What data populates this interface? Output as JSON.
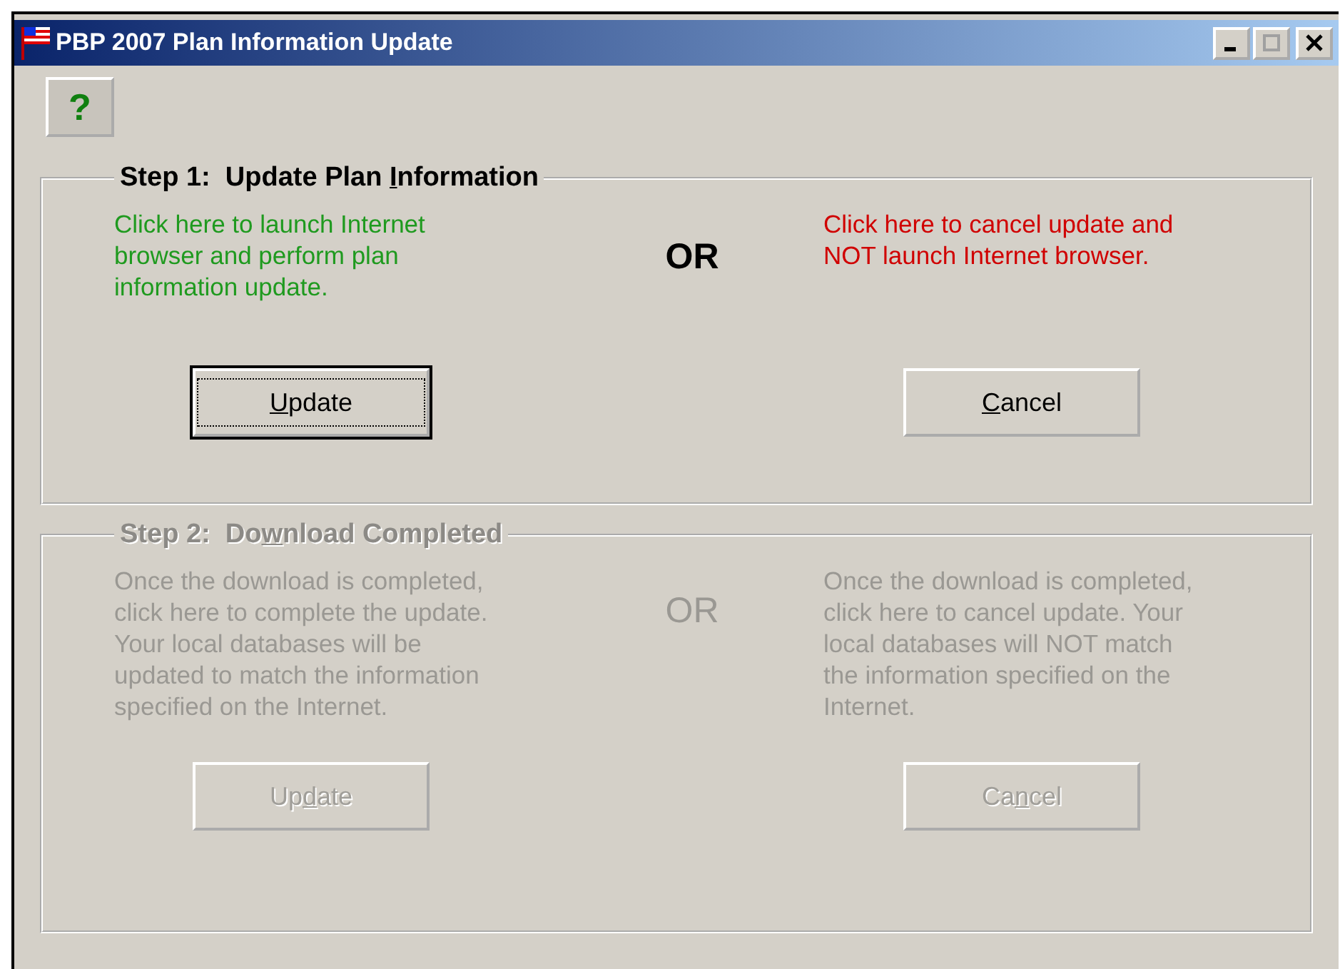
{
  "window": {
    "title": "PBP 2007 Plan Information Update",
    "maximize": {
      "disabled": true
    }
  },
  "help_button": {
    "label": "?"
  },
  "steps": [
    {
      "title": {
        "before": "Step 1:  Update Plan ",
        "key": "I",
        "after": "nformation"
      },
      "enabled": true,
      "separator": "OR",
      "options": [
        {
          "kind": "proceed",
          "text": "Click here to launch Internet\nbrowser and perform plan\ninformation update.",
          "button": {
            "key": "U",
            "after": "pdate",
            "focused": true
          }
        },
        {
          "kind": "cancel",
          "text": "Click here to cancel update and\nNOT launch Internet browser.",
          "button": {
            "key": "C",
            "after": "ancel",
            "focused": false
          }
        }
      ]
    },
    {
      "title": {
        "before": "Step 2:  Do",
        "key": "w",
        "after": "nload Completed"
      },
      "enabled": false,
      "separator": "OR",
      "options": [
        {
          "kind": "proceed",
          "text": "Once the download is completed,\nclick here to complete the update.\nYour local databases will be\nupdated to match the information\nspecified on the Internet.",
          "button": {
            "before": "Up",
            "key": "d",
            "after": "ate",
            "focused": false
          }
        },
        {
          "kind": "cancel",
          "text": "Once the download is completed,\nclick here to cancel update.  Your\nlocal databases will NOT match\nthe information specified on the\nInternet.",
          "button": {
            "before": "Ca",
            "key": "n",
            "after": "cel",
            "focused": false
          }
        }
      ]
    }
  ]
}
